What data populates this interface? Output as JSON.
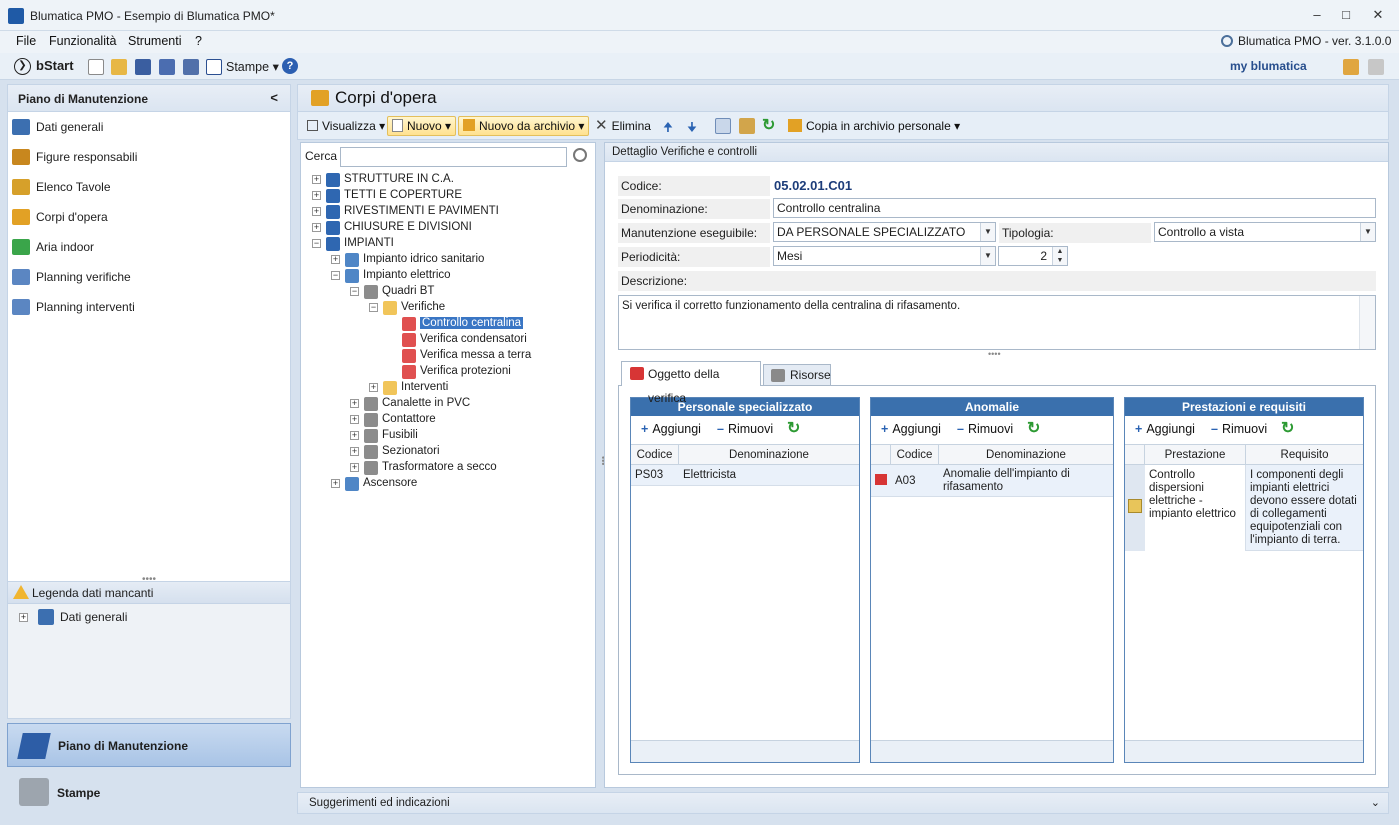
{
  "window": {
    "title": "Blumatica PMO - Esempio di Blumatica PMO*",
    "version": "Blumatica PMO - ver. 3.1.0.0"
  },
  "menu": [
    "File",
    "Funzionalità",
    "Strumenti",
    "?"
  ],
  "toolbar": {
    "bstart": "bStart",
    "stampe": "Stampe",
    "brand": "my blumatica"
  },
  "left_panel": {
    "title": "Piano di Manutenzione",
    "collapse": "<",
    "items": [
      {
        "label": "Dati generali",
        "icon": "building-icon",
        "color": "#3c6fb0"
      },
      {
        "label": "Figure responsabili",
        "icon": "crane-icon",
        "color": "#c8871e"
      },
      {
        "label": "Elenco Tavole",
        "icon": "drawings-icon",
        "color": "#d6a02a"
      },
      {
        "label": "Corpi d'opera",
        "icon": "components-icon",
        "color": "#e2a125"
      },
      {
        "label": "Aria indoor",
        "icon": "house-icon",
        "color": "#3aa54a"
      },
      {
        "label": "Planning verifiche",
        "icon": "planning-icon",
        "color": "#5b86c2"
      },
      {
        "label": "Planning interventi",
        "icon": "planning-icon",
        "color": "#5b86c2"
      }
    ],
    "legend": {
      "title": "Legenda dati mancanti",
      "item": "Dati generali"
    },
    "nav": [
      {
        "label": "Piano di Manutenzione"
      },
      {
        "label": "Stampe"
      }
    ]
  },
  "main": {
    "title": "Corpi d'opera",
    "toolbar": {
      "visualizza": "Visualizza",
      "nuovo": "Nuovo",
      "nuovo_archivio": "Nuovo da archivio",
      "elimina": "Elimina",
      "copia": "Copia in archivio personale"
    },
    "search": {
      "label": "Cerca",
      "value": ""
    }
  },
  "tree": [
    {
      "label": "STRUTTURE IN C.A.",
      "level": 0,
      "exp": "+",
      "icon": "structure-icon"
    },
    {
      "label": "TETTI E COPERTURE",
      "level": 0,
      "exp": "+",
      "icon": "structure-icon"
    },
    {
      "label": "RIVESTIMENTI E PAVIMENTI",
      "level": 0,
      "exp": "+",
      "icon": "structure-icon"
    },
    {
      "label": "CHIUSURE E DIVISIONI",
      "level": 0,
      "exp": "+",
      "icon": "structure-icon"
    },
    {
      "label": "IMPIANTI",
      "level": 0,
      "exp": "-",
      "icon": "structure-icon"
    },
    {
      "label": "Impianto idrico sanitario",
      "level": 1,
      "exp": "+",
      "icon": "system-icon"
    },
    {
      "label": "Impianto elettrico",
      "level": 1,
      "exp": "-",
      "icon": "system-icon"
    },
    {
      "label": "Quadri BT",
      "level": 2,
      "exp": "-",
      "icon": "tools-icon"
    },
    {
      "label": "Verifiche",
      "level": 3,
      "exp": "-",
      "icon": "folder-icon"
    },
    {
      "label": "Controllo centralina",
      "level": 4,
      "exp": "",
      "icon": "checklist-icon",
      "selected": true
    },
    {
      "label": "Verifica condensatori",
      "level": 4,
      "exp": "",
      "icon": "checklist-icon"
    },
    {
      "label": "Verifica messa a terra",
      "level": 4,
      "exp": "",
      "icon": "checklist-icon"
    },
    {
      "label": "Verifica protezioni",
      "level": 4,
      "exp": "",
      "icon": "checklist-icon"
    },
    {
      "label": "Interventi",
      "level": 3,
      "exp": "+",
      "icon": "folder-icon"
    },
    {
      "label": "Canalette in PVC",
      "level": 2,
      "exp": "+",
      "icon": "tools-icon"
    },
    {
      "label": "Contattore",
      "level": 2,
      "exp": "+",
      "icon": "tools-icon"
    },
    {
      "label": "Fusibili",
      "level": 2,
      "exp": "+",
      "icon": "tools-icon"
    },
    {
      "label": "Sezionatori",
      "level": 2,
      "exp": "+",
      "icon": "tools-icon"
    },
    {
      "label": "Trasformatore a secco",
      "level": 2,
      "exp": "+",
      "icon": "tools-icon"
    },
    {
      "label": "Ascensore",
      "level": 1,
      "exp": "+",
      "icon": "system-icon"
    }
  ],
  "detail": {
    "header": "Dettaglio Verifiche e controlli",
    "codice_label": "Codice:",
    "codice": "05.02.01.C01",
    "denominazione_label": "Denominazione:",
    "denominazione": "Controllo centralina",
    "manutenzione_label": "Manutenzione eseguibile:",
    "manutenzione": "DA PERSONALE SPECIALIZZATO",
    "tipologia_label": "Tipologia:",
    "tipologia": "Controllo a vista",
    "periodicita_label": "Periodicità:",
    "periodicita": "Mesi",
    "periodicita_value": "2",
    "descrizione_label": "Descrizione:",
    "descrizione": "Si verifica il corretto funzionamento della centralina di rifasamento.",
    "tabs": [
      "Oggetto della verifica",
      "Risorse"
    ]
  },
  "grids": {
    "add": "Aggiungi",
    "remove": "Rimuovi",
    "personale": {
      "title": "Personale specializzato",
      "columns": [
        "Codice",
        "Denominazione"
      ],
      "rows": [
        {
          "codice": "PS03",
          "denominazione": "Elettricista"
        }
      ]
    },
    "anomalie": {
      "title": "Anomalie",
      "columns": [
        "Codice",
        "Denominazione"
      ],
      "rows": [
        {
          "codice": "A03",
          "denominazione": "Anomalie dell'impianto di rifasamento"
        }
      ]
    },
    "prestazioni": {
      "title": "Prestazioni e requisiti",
      "columns": [
        "Prestazione",
        "Requisito"
      ],
      "rows": [
        {
          "prestazione": "Controllo dispersioni elettriche - impianto elettrico",
          "requisito": "I componenti degli impianti elettrici devono essere dotati di collegamenti equipotenziali con l'impianto di terra."
        }
      ]
    }
  },
  "statusbar": {
    "label": "Suggerimenti ed indicazioni"
  },
  "colors": {
    "accent": "#3a70ad",
    "selected": "#3a76c4",
    "codice": "#1d3d7a"
  }
}
